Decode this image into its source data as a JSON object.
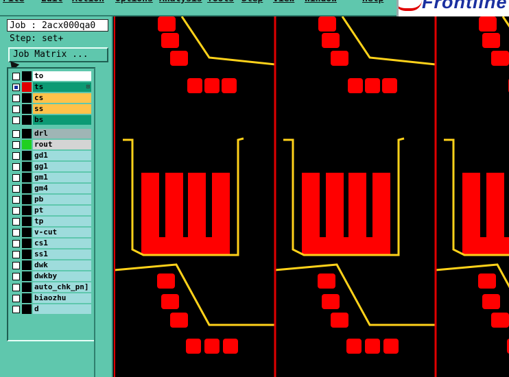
{
  "menu": [
    "File",
    "Edit",
    "Action",
    "Options",
    "Analysis",
    "Tools",
    "Step",
    "View",
    "Window",
    "Help"
  ],
  "logo": "Frontline",
  "job": {
    "job_label": "Job : 2acx000qa0",
    "step_label": "Step: set+",
    "matrix_button": "Job Matrix ..."
  },
  "layers": [
    {
      "name": "to",
      "checked": false,
      "swatch": "#000000",
      "bg": "#ffffff",
      "mark": ""
    },
    {
      "name": "ts",
      "checked": true,
      "swatch": "#e00000",
      "bg": "#0c9a74",
      "mark": "⊞"
    },
    {
      "name": "cs",
      "checked": false,
      "swatch": "#000000",
      "bg": "#ffc24a",
      "mark": ""
    },
    {
      "name": "ss",
      "checked": false,
      "swatch": "#000000",
      "bg": "#ffc24a",
      "mark": ""
    },
    {
      "name": "bs",
      "checked": false,
      "swatch": "#000000",
      "bg": "#0c9a74",
      "mark": ""
    },
    {
      "name": "drl",
      "checked": false,
      "swatch": "#000000",
      "bg": "#9fb5b5",
      "mark": ""
    },
    {
      "name": "rout",
      "checked": false,
      "swatch": "#20d020",
      "bg": "#d4d4d4",
      "mark": ""
    },
    {
      "name": "gd1",
      "checked": false,
      "swatch": "#000000",
      "bg": "#9edcdc",
      "mark": ""
    },
    {
      "name": "gg1",
      "checked": false,
      "swatch": "#000000",
      "bg": "#9edcdc",
      "mark": ""
    },
    {
      "name": "gm1",
      "checked": false,
      "swatch": "#000000",
      "bg": "#9edcdc",
      "mark": ""
    },
    {
      "name": "gm4",
      "checked": false,
      "swatch": "#000000",
      "bg": "#9edcdc",
      "mark": ""
    },
    {
      "name": "pb",
      "checked": false,
      "swatch": "#000000",
      "bg": "#9edcdc",
      "mark": ""
    },
    {
      "name": "pt",
      "checked": false,
      "swatch": "#000000",
      "bg": "#9edcdc",
      "mark": ""
    },
    {
      "name": "tp",
      "checked": false,
      "swatch": "#000000",
      "bg": "#9edcdc",
      "mark": ""
    },
    {
      "name": "v-cut",
      "checked": false,
      "swatch": "#000000",
      "bg": "#9edcdc",
      "mark": ""
    },
    {
      "name": "cs1",
      "checked": false,
      "swatch": "#000000",
      "bg": "#9edcdc",
      "mark": ""
    },
    {
      "name": "ss1",
      "checked": false,
      "swatch": "#000000",
      "bg": "#9edcdc",
      "mark": ""
    },
    {
      "name": "dwk",
      "checked": false,
      "swatch": "#000000",
      "bg": "#9edcdc",
      "mark": ""
    },
    {
      "name": "dwkby",
      "checked": false,
      "swatch": "#000000",
      "bg": "#9edcdc",
      "mark": ""
    },
    {
      "name": "auto_chk_pn]",
      "checked": false,
      "swatch": "#000000",
      "bg": "#9edcdc",
      "mark": ""
    },
    {
      "name": "biaozhu",
      "checked": false,
      "swatch": "#000000",
      "bg": "#9edcdc",
      "mark": ""
    },
    {
      "name": "d",
      "checked": false,
      "swatch": "#000000",
      "bg": "#9edcdc",
      "mark": ""
    }
  ],
  "colors": {
    "pad": "#ff0000",
    "outline": "#ffd21a",
    "divider": "#e00000",
    "canvas": "#000000"
  }
}
